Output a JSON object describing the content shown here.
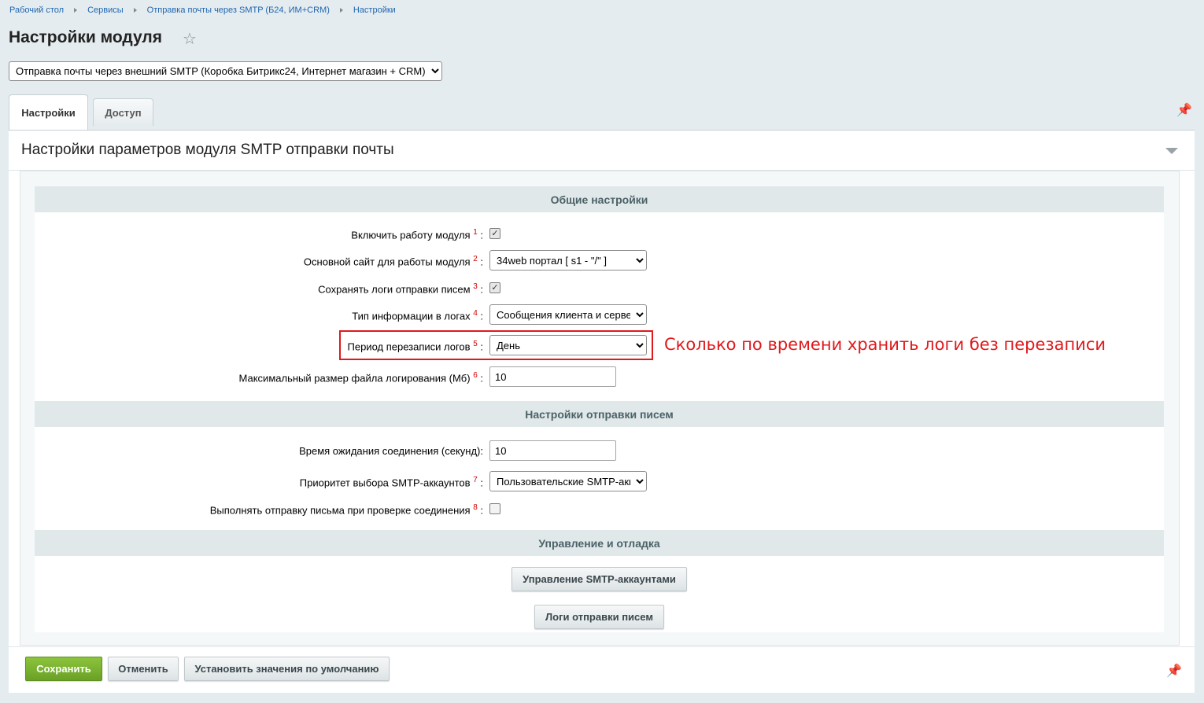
{
  "breadcrumbs": [
    "Рабочий стол",
    "Сервисы",
    "Отправка почты через SMTP (Б24, ИМ+CRM)",
    "Настройки"
  ],
  "page_title": "Настройки модуля",
  "module_select": {
    "selected": "Отправка почты через внешний SMTP (Коробка Битрикс24, Интернет магазин + CRM)"
  },
  "tabs": [
    {
      "label": "Настройки",
      "active": true
    },
    {
      "label": "Доступ",
      "active": false
    }
  ],
  "panel_title": "Настройки параметров модуля SMTP отправки почты",
  "sections": {
    "general": "Общие настройки",
    "sending": "Настройки отправки писем",
    "management": "Управление и отладка"
  },
  "fields": {
    "enable_module": {
      "label": "Включить работу модуля",
      "sup": "1",
      "checked": true
    },
    "main_site": {
      "label": "Основной сайт для работы модуля",
      "sup": "2",
      "value": "34web портал [ s1 - \"/\" ]"
    },
    "save_logs": {
      "label": "Сохранять логи отправки писем",
      "sup": "3",
      "checked": true
    },
    "log_info_type": {
      "label": "Тип информации в логах",
      "sup": "4",
      "value": "Сообщения клиента и сервера"
    },
    "log_period": {
      "label": "Период перезаписи логов",
      "sup": "5",
      "value": "День"
    },
    "max_log_size": {
      "label": "Максимальный размер файла логирования (Мб)",
      "sup": "6",
      "value": "10"
    },
    "timeout": {
      "label": "Время ожидания соединения (секунд):",
      "value": "10"
    },
    "smtp_priority": {
      "label": "Приоритет выбора SMTP-аккаунтов",
      "sup": "7",
      "value": "Пользовательские SMTP-аккаунты"
    },
    "send_on_check": {
      "label": "Выполнять отправку письма при проверке соединения",
      "sup": "8",
      "checked": false
    }
  },
  "annotation": "Сколько по времени хранить логи без перезаписи",
  "buttons": {
    "manage_accounts": "Управление SMTP-аккаунтами",
    "send_logs": "Логи отправки писем",
    "save": "Сохранить",
    "cancel": "Отменить",
    "defaults": "Установить значения по умолчанию"
  },
  "colors": {
    "accent_green": "#7cb32f",
    "link_blue": "#2067b0",
    "annotation_red": "#e0191c"
  }
}
